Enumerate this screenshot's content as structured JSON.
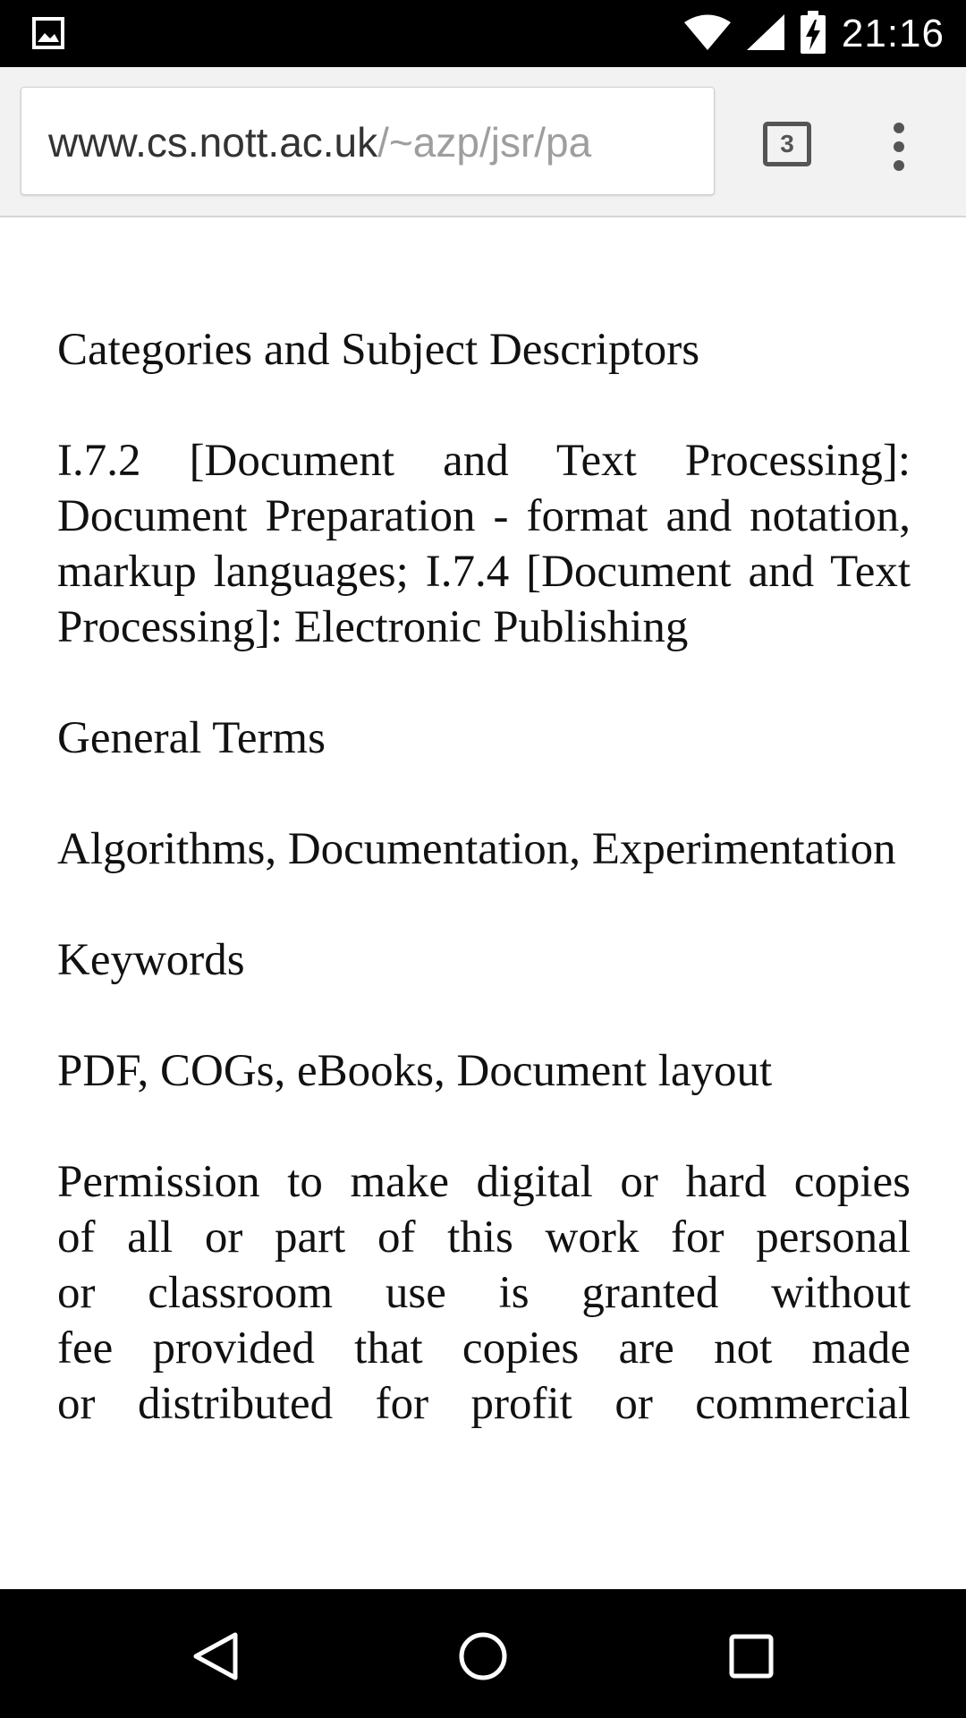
{
  "status_bar": {
    "time": "21:16",
    "icons": [
      "image-notification-icon",
      "wifi-icon",
      "signal-icon",
      "battery-charging-icon"
    ]
  },
  "browser": {
    "url_host": "www.cs.nott.ac.uk",
    "url_path": "/~azp/jsr/pa",
    "tab_count": "3",
    "icons": [
      "tab-switcher-icon",
      "overflow-menu-icon"
    ]
  },
  "document": {
    "categories_heading": "Categories and Subject Descriptors",
    "categories_lines": [
      "I.7.2 [Document and Text Processing]:",
      "Document Preparation - format and notation,",
      "markup languages; I.7.4 [Document and Text",
      "Processing]: Electronic Publishing"
    ],
    "general_terms_heading": "General Terms",
    "general_terms": "Algorithms, Documentation, Experimentation",
    "keywords_heading": "Keywords",
    "keywords": "PDF, COGs, eBooks, Document layout",
    "permission_lines": [
      "Permission to make digital or hard copies",
      "of all or part of this work for personal",
      "or classroom use is granted without",
      "fee provided that copies are not made",
      "or distributed for profit or commercial"
    ]
  },
  "nav_bar": {
    "icons": [
      "back-icon",
      "home-icon",
      "recents-icon"
    ]
  }
}
